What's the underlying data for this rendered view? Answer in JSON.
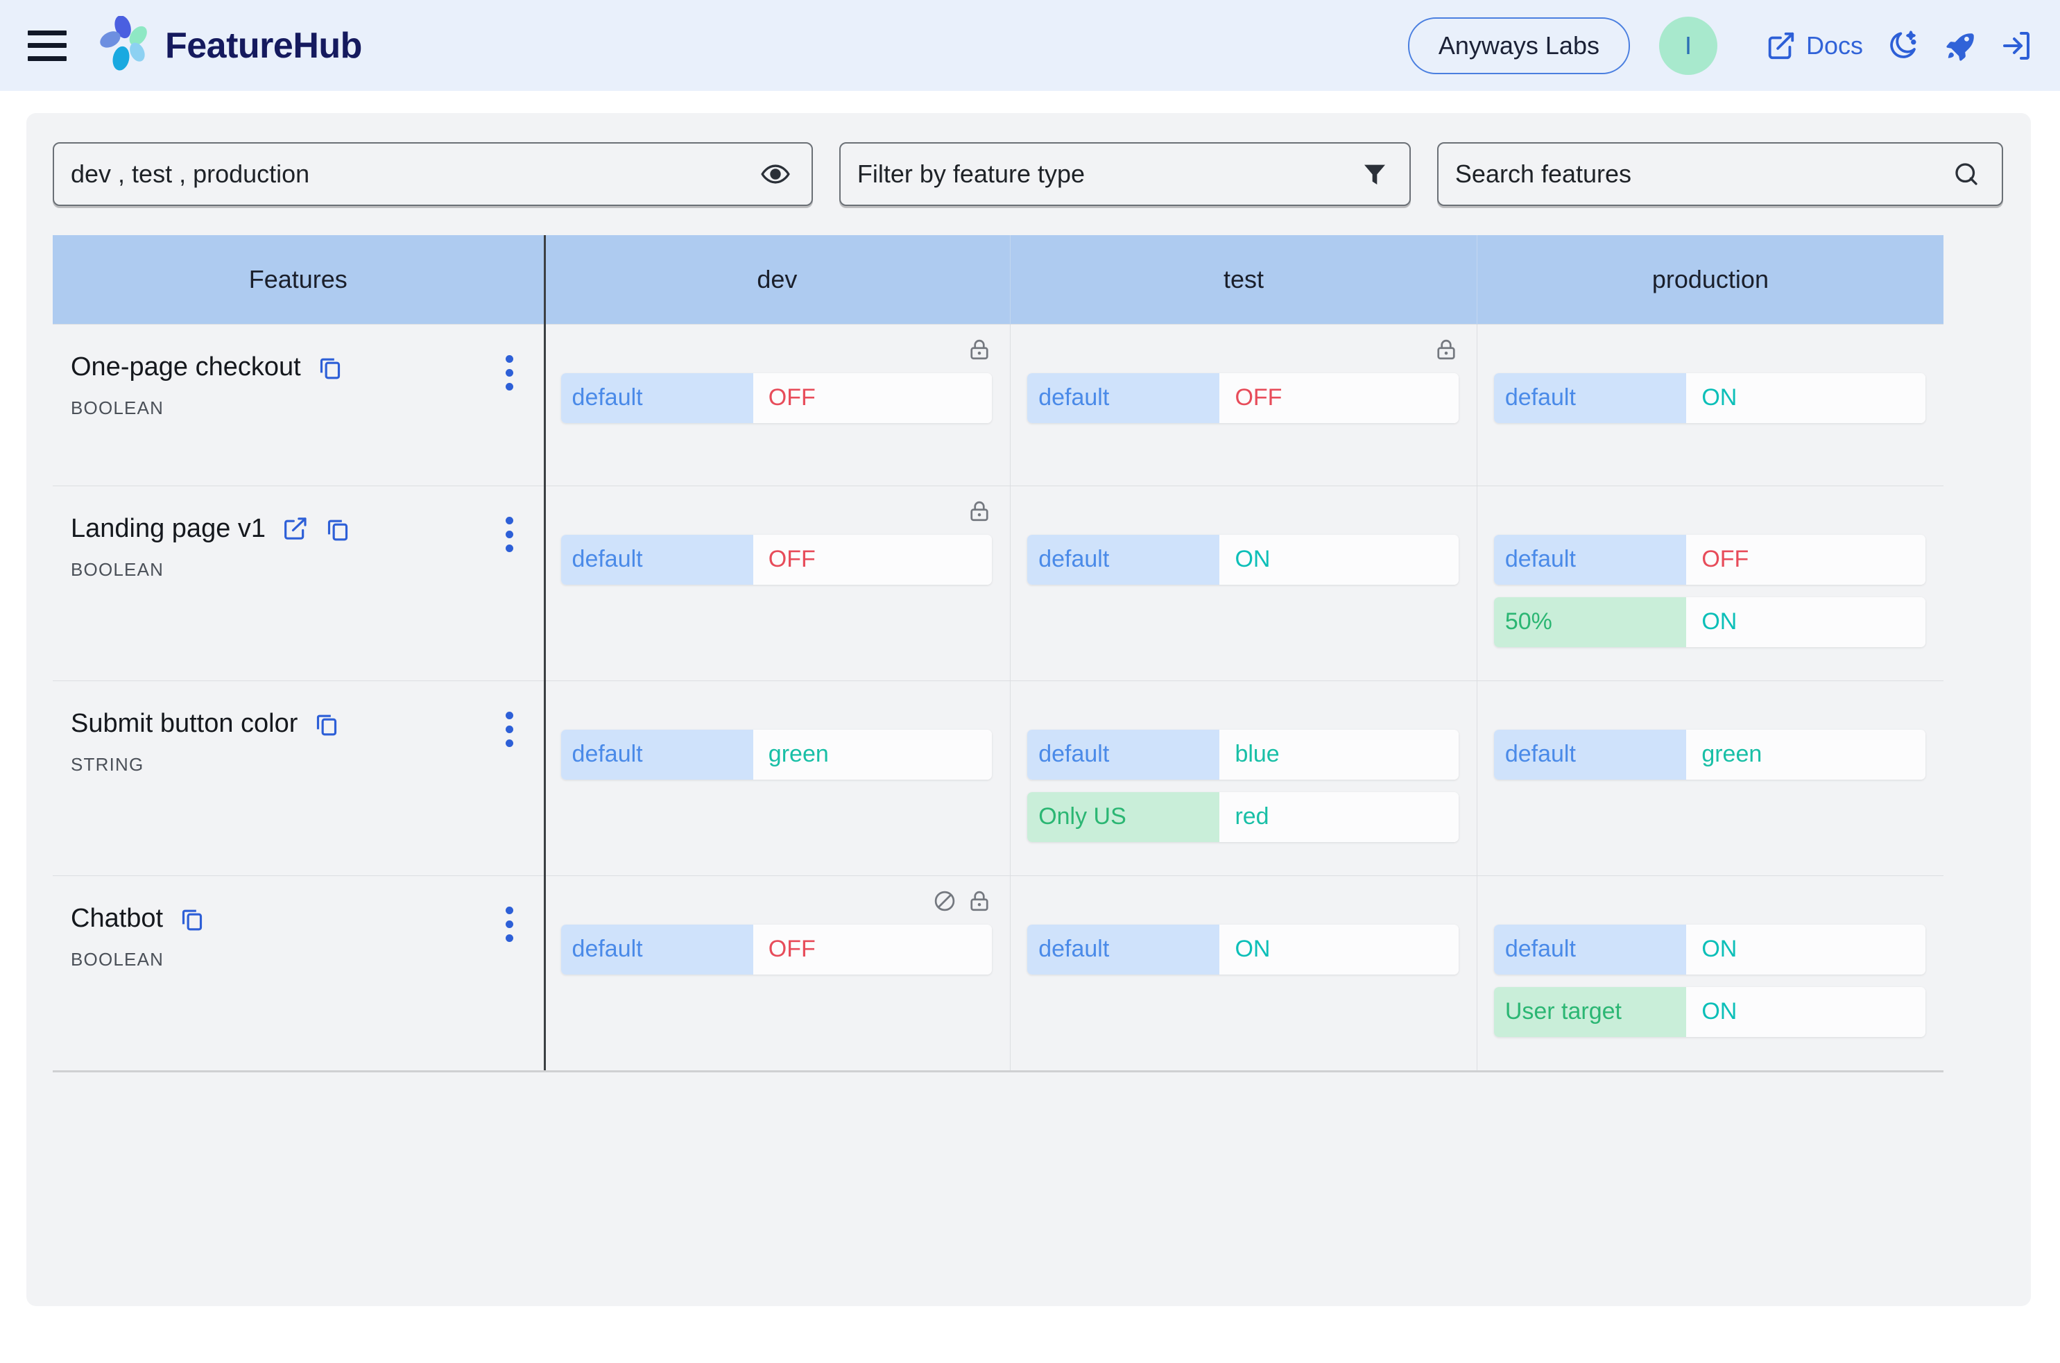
{
  "header": {
    "menu_icon": "hamburger-menu-icon",
    "brand_name": "FeatureHub",
    "portfolio": "Anyways Labs",
    "avatar_initial": "I",
    "docs_label": "Docs",
    "icons": [
      "external-link-icon",
      "dark-mode-icon",
      "rocket-icon",
      "logout-icon"
    ]
  },
  "filters": {
    "environments_value": "dev , test , production",
    "environments_icon": "eye-icon",
    "feature_type_placeholder": "Filter by feature type",
    "feature_type_icon": "filter-icon",
    "search_placeholder": "Search features",
    "search_icon": "search-icon"
  },
  "table": {
    "columns": [
      "Features",
      "dev",
      "test",
      "production"
    ],
    "rows": [
      {
        "name": "One-page checkout",
        "type": "BOOLEAN",
        "has_link": false,
        "cells": [
          {
            "env": "dev",
            "locked": true,
            "disabled": false,
            "strategies": [
              {
                "name": "default",
                "kind": "default",
                "value": "OFF",
                "value_kind": "off"
              }
            ]
          },
          {
            "env": "test",
            "locked": true,
            "disabled": false,
            "strategies": [
              {
                "name": "default",
                "kind": "default",
                "value": "OFF",
                "value_kind": "off"
              }
            ]
          },
          {
            "env": "production",
            "locked": false,
            "disabled": false,
            "strategies": [
              {
                "name": "default",
                "kind": "default",
                "value": "ON",
                "value_kind": "on"
              }
            ]
          }
        ]
      },
      {
        "name": "Landing page v1",
        "type": "BOOLEAN",
        "has_link": true,
        "cells": [
          {
            "env": "dev",
            "locked": true,
            "disabled": false,
            "strategies": [
              {
                "name": "default",
                "kind": "default",
                "value": "OFF",
                "value_kind": "off"
              }
            ]
          },
          {
            "env": "test",
            "locked": false,
            "disabled": false,
            "strategies": [
              {
                "name": "default",
                "kind": "default",
                "value": "ON",
                "value_kind": "on"
              }
            ]
          },
          {
            "env": "production",
            "locked": false,
            "disabled": false,
            "strategies": [
              {
                "name": "default",
                "kind": "default",
                "value": "OFF",
                "value_kind": "off"
              },
              {
                "name": "50%",
                "kind": "custom",
                "value": "ON",
                "value_kind": "on"
              }
            ]
          }
        ]
      },
      {
        "name": "Submit button color",
        "type": "STRING",
        "has_link": false,
        "cells": [
          {
            "env": "dev",
            "locked": false,
            "disabled": false,
            "strategies": [
              {
                "name": "default",
                "kind": "default",
                "value": "green",
                "value_kind": "str"
              }
            ]
          },
          {
            "env": "test",
            "locked": false,
            "disabled": false,
            "strategies": [
              {
                "name": "default",
                "kind": "default",
                "value": "blue",
                "value_kind": "str"
              },
              {
                "name": "Only US",
                "kind": "custom",
                "value": "red",
                "value_kind": "str"
              }
            ]
          },
          {
            "env": "production",
            "locked": false,
            "disabled": false,
            "strategies": [
              {
                "name": "default",
                "kind": "default",
                "value": "green",
                "value_kind": "str"
              }
            ]
          }
        ]
      },
      {
        "name": "Chatbot",
        "type": "BOOLEAN",
        "has_link": false,
        "cells": [
          {
            "env": "dev",
            "locked": true,
            "disabled": true,
            "strategies": [
              {
                "name": "default",
                "kind": "default",
                "value": "OFF",
                "value_kind": "off"
              }
            ]
          },
          {
            "env": "test",
            "locked": false,
            "disabled": false,
            "strategies": [
              {
                "name": "default",
                "kind": "default",
                "value": "ON",
                "value_kind": "on"
              }
            ]
          },
          {
            "env": "production",
            "locked": false,
            "disabled": false,
            "strategies": [
              {
                "name": "default",
                "kind": "default",
                "value": "ON",
                "value_kind": "on"
              },
              {
                "name": "User target",
                "kind": "custom",
                "value": "ON",
                "value_kind": "on"
              }
            ]
          }
        ]
      }
    ]
  },
  "colors": {
    "header_bg": "#e9f0fb",
    "table_header_bg": "#aecbf0",
    "brand": "#151a5e",
    "accent_blue": "#3163d8",
    "default_chip": "#cfe2fb",
    "custom_chip": "#c9eed9",
    "on": "#0cbfb8",
    "off": "#e74c5a",
    "avatar_bg": "#a8e9cd"
  }
}
